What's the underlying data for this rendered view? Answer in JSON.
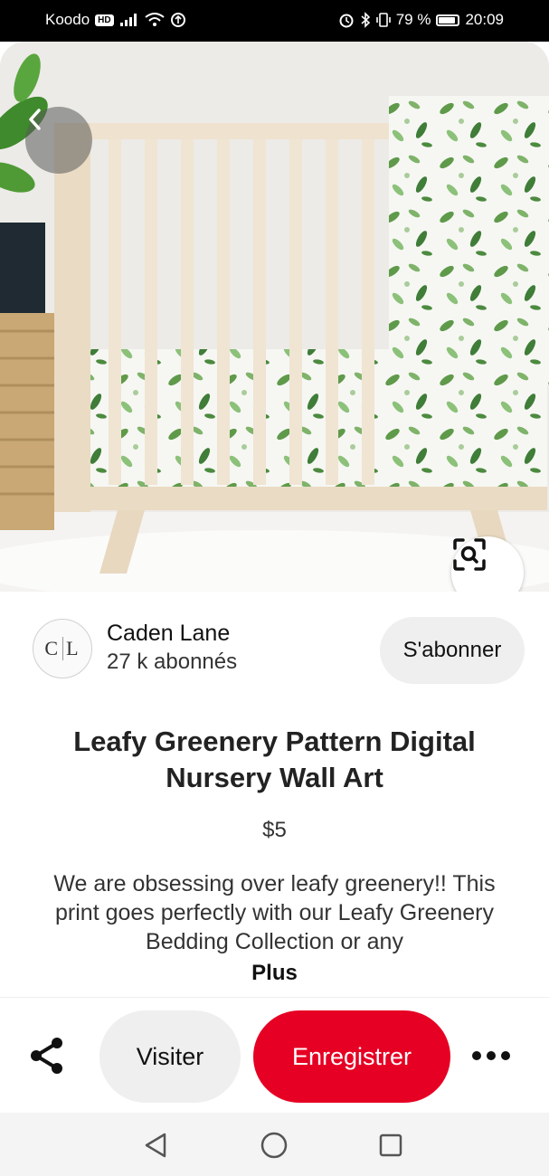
{
  "status_bar": {
    "carrier": "Koodo",
    "network_badge": "HD",
    "battery_text": "79 %",
    "battery_level": 0.79,
    "time": "20:09",
    "icons": [
      "signal-icon",
      "wifi-icon",
      "data-saver-icon",
      "alarm-icon",
      "bluetooth-icon",
      "vibrate-icon",
      "battery-icon"
    ]
  },
  "hero": {
    "back_icon": "chevron-left-icon",
    "visual_search_icon": "lens-search-icon"
  },
  "creator": {
    "avatar_left": "C",
    "avatar_right": "L",
    "name": "Caden Lane",
    "followers": "27 k abonnés",
    "follow_label": "S'abonner"
  },
  "pin": {
    "title": "Leafy Greenery Pattern Digital Nursery Wall Art",
    "price": "$5",
    "description": "We are obsessing over leafy greenery!! This print goes perfectly with our Leafy Greenery Bedding Collection or any",
    "more_label": "Plus"
  },
  "actions": {
    "share_icon": "share-icon",
    "visit_label": "Visiter",
    "save_label": "Enregistrer",
    "save_color": "#e60023",
    "more_icon": "more-dots-icon"
  },
  "nav": {
    "icons": [
      "back-triangle-icon",
      "home-circle-icon",
      "recents-square-icon"
    ]
  }
}
